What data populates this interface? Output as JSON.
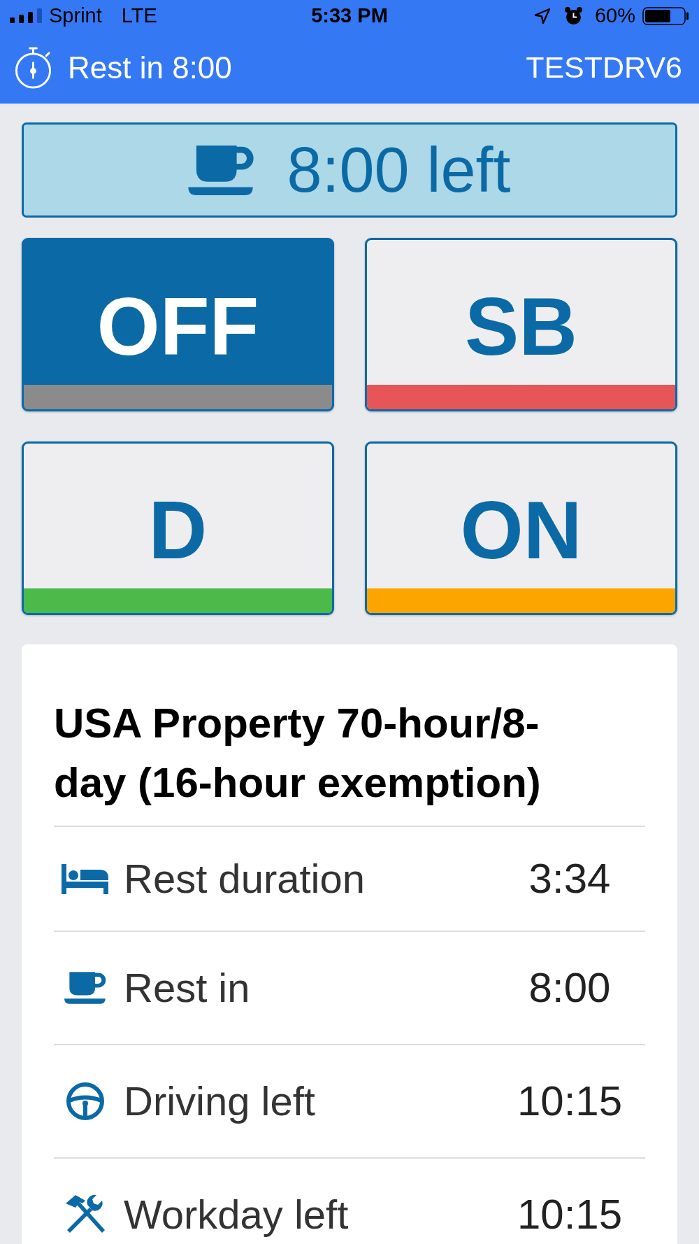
{
  "status_bar": {
    "carrier": "Sprint",
    "network": "LTE",
    "time": "5:33 PM",
    "battery": "60%"
  },
  "header": {
    "title": "Rest in 8:00",
    "driver_id": "TESTDRV6"
  },
  "banner": {
    "text": "8:00 left"
  },
  "duty_buttons": [
    {
      "label": "OFF",
      "selected": true,
      "color": "#8b8b8b"
    },
    {
      "label": "SB",
      "selected": false,
      "color": "#e85557"
    },
    {
      "label": "D",
      "selected": false,
      "color": "#4cb94b"
    },
    {
      "label": "ON",
      "selected": false,
      "color": "#fca500"
    }
  ],
  "card": {
    "title": "USA Property 70-hour/8-day (16-hour exemption)",
    "rows": [
      {
        "kind": "rest",
        "label": "Rest duration",
        "value": "3:34"
      },
      {
        "kind": "break",
        "label": "Rest in",
        "value": "8:00"
      },
      {
        "kind": "driving",
        "label": "Driving left",
        "value": "10:15"
      },
      {
        "kind": "workday",
        "label": "Workday left",
        "value": "10:15"
      }
    ]
  }
}
